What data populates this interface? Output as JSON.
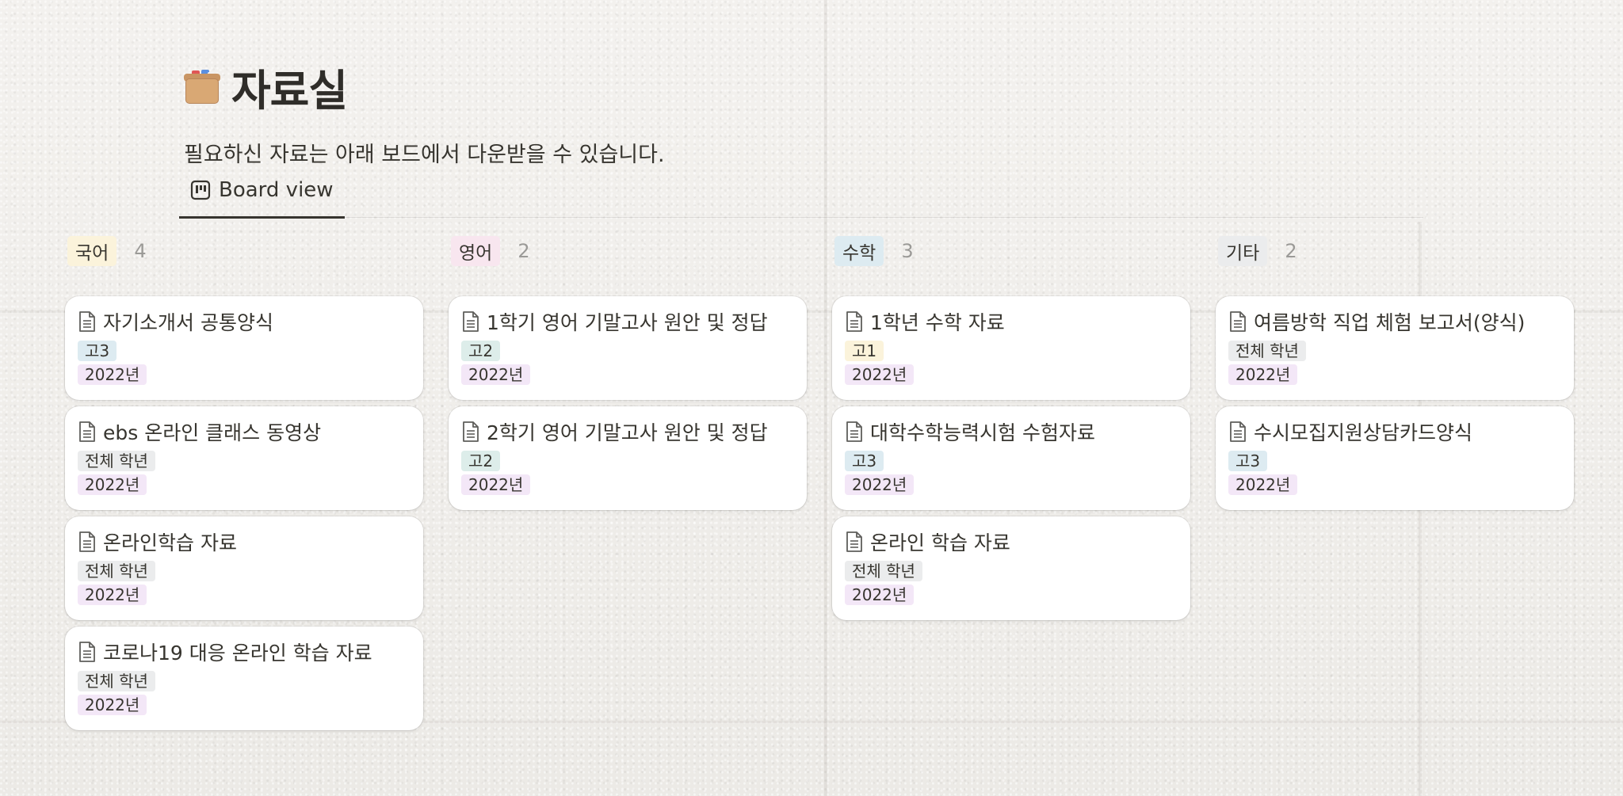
{
  "page": {
    "title": "자료실",
    "icon": "package-box-icon",
    "subtitle": "필요하신 자료는 아래 보드에서 다운받을 수 있습니다."
  },
  "view_tab": {
    "label": "Board view",
    "icon": "board-view-icon"
  },
  "colors": {
    "korean_tag": "#fbf3db",
    "english_tag": "#f8e6ef",
    "math_tag": "#ddebf1",
    "etc_tag": "#ebeced",
    "grade3": "#ddebf1",
    "grade2": "#ddedea",
    "grade1": "#fbf3db",
    "all_grades": "#ebeced",
    "year": "#f3e7f7"
  },
  "columns": [
    {
      "label": "국어",
      "count": "4",
      "cards": [
        {
          "title": "자기소개서 공통양식",
          "grade": "고3",
          "year": "2022년"
        },
        {
          "title": "ebs 온라인 클래스 동영상",
          "grade": "전체 학년",
          "year": "2022년"
        },
        {
          "title": "온라인학습 자료",
          "grade": "전체 학년",
          "year": "2022년"
        },
        {
          "title": "코로나19 대응 온라인 학습 자료",
          "grade": "전체 학년",
          "year": "2022년"
        }
      ]
    },
    {
      "label": "영어",
      "count": "2",
      "cards": [
        {
          "title": "1학기 영어 기말고사 원안 및 정답",
          "grade": "고2",
          "year": "2022년"
        },
        {
          "title": "2학기 영어 기말고사 원안 및 정답",
          "grade": "고2",
          "year": "2022년"
        }
      ]
    },
    {
      "label": "수학",
      "count": "3",
      "cards": [
        {
          "title": "1학년 수학 자료",
          "grade": "고1",
          "year": "2022년"
        },
        {
          "title": "대학수학능력시험 수험자료",
          "grade": "고3",
          "year": "2022년"
        },
        {
          "title": "온라인 학습 자료",
          "grade": "전체 학년",
          "year": "2022년"
        }
      ]
    },
    {
      "label": "기타",
      "count": "2",
      "cards": [
        {
          "title": "여름방학 직업 체험 보고서(양식)",
          "grade": "전체 학년",
          "year": "2022년"
        },
        {
          "title": "수시모집지원상담카드양식",
          "grade": "고3",
          "year": "2022년"
        }
      ]
    }
  ]
}
